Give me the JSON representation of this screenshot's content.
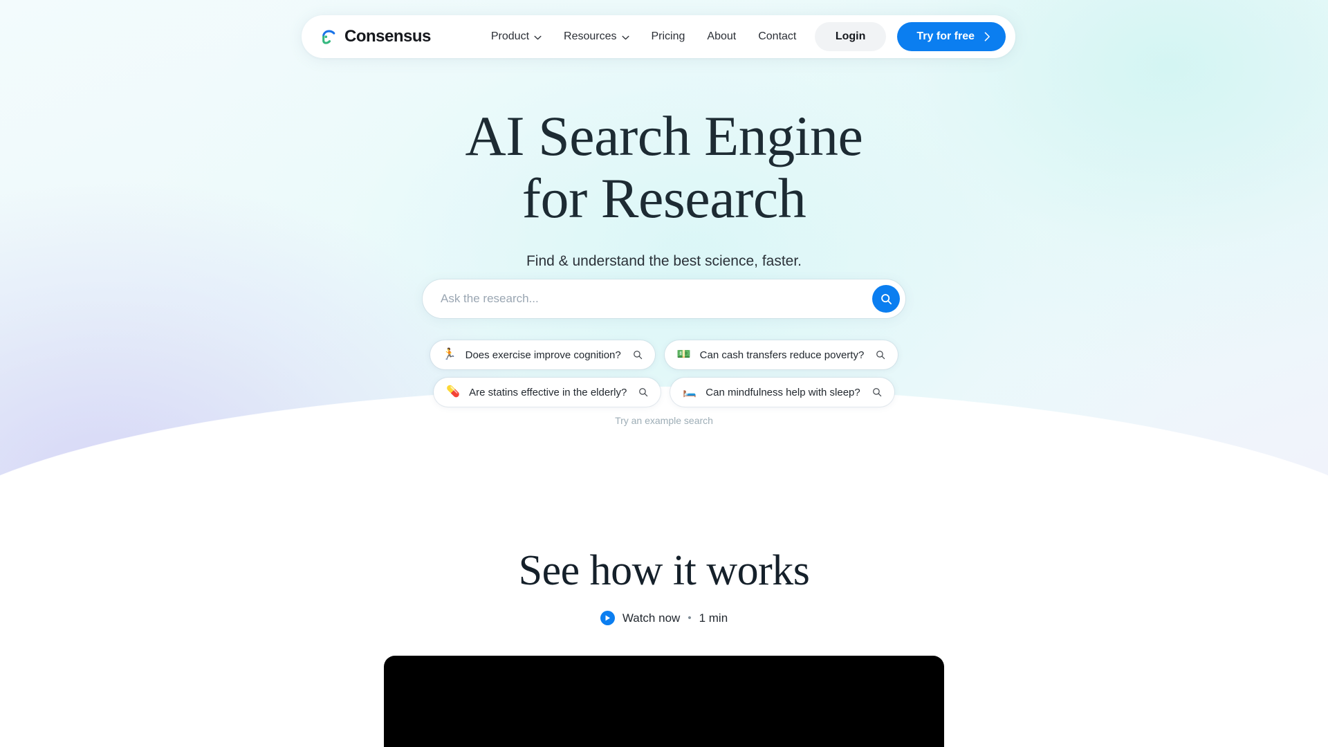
{
  "brand": {
    "name": "Consensus",
    "logo_icon": "consensus-c-logo",
    "blue": "#1a73e8",
    "green": "#35b87f"
  },
  "nav": {
    "items": [
      {
        "label": "Product",
        "has_dropdown": true,
        "icon": "chevron-down-icon"
      },
      {
        "label": "Resources",
        "has_dropdown": true,
        "icon": "chevron-down-icon"
      },
      {
        "label": "Pricing",
        "has_dropdown": false
      },
      {
        "label": "About",
        "has_dropdown": false
      },
      {
        "label": "Contact",
        "has_dropdown": false
      }
    ],
    "login_label": "Login",
    "cta_label": "Try for free",
    "cta_icon": "chevron-right-icon",
    "cta_color": "#0b7ef0"
  },
  "hero": {
    "title_line1": "AI Search Engine",
    "title_line2": "for Research",
    "subtitle": "Find & understand the best science, faster."
  },
  "search": {
    "placeholder": "Ask the research...",
    "value": "",
    "button_icon": "search-icon",
    "button_color": "#0b7ef0"
  },
  "examples": {
    "hint": "Try an example search",
    "chips": [
      {
        "emoji": "🏃",
        "emoji_name": "runner-emoji",
        "text": "Does exercise improve cognition?",
        "icon": "search-icon"
      },
      {
        "emoji": "💵",
        "emoji_name": "money-emoji",
        "text": "Can cash transfers reduce poverty?",
        "icon": "search-icon"
      },
      {
        "emoji": "💊",
        "emoji_name": "pill-emoji",
        "text": "Are statins effective in the elderly?",
        "icon": "search-icon"
      },
      {
        "emoji": "🛏️",
        "emoji_name": "bed-emoji",
        "text": "Can mindfulness help with sleep?",
        "icon": "search-icon"
      }
    ]
  },
  "how_it_works": {
    "title": "See how it works",
    "watch_label": "Watch now",
    "separator": "•",
    "duration": "1 min",
    "play_icon": "play-icon"
  }
}
